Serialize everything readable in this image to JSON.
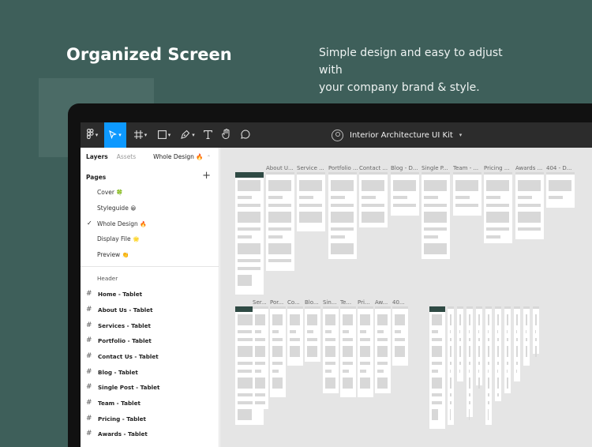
{
  "hero": {
    "title": "Organized Screen",
    "subtitle_line1": "Simple design and easy to adjust with",
    "subtitle_line2": "your company brand & style."
  },
  "toolbar": {
    "file_name": "Interior Architecture UI Kit",
    "accent": "#0d99ff",
    "tools": [
      "figma-menu-icon",
      "move-tool-icon",
      "frame-tool-icon",
      "shape-tool-icon",
      "pen-tool-icon",
      "text-tool-icon",
      "hand-tool-icon",
      "comment-icon"
    ]
  },
  "sidebar": {
    "tab_layers": "Layers",
    "tab_assets": "Assets",
    "current_page": "Whole Design",
    "current_page_emoji": "🔥",
    "pages_heading": "Pages",
    "pages": [
      {
        "label": "Cover",
        "emoji": "🍀"
      },
      {
        "label": "Styleguide",
        "emoji": "😀"
      },
      {
        "label": "Whole Design",
        "emoji": "🔥"
      },
      {
        "label": "Display File",
        "emoji": "🌟"
      },
      {
        "label": "Preview",
        "emoji": "👏"
      }
    ],
    "layers": [
      "Header",
      "Home - Tablet",
      "About Us - Tablet",
      "Services - Tablet",
      "Portfolio - Tablet",
      "Contact Us - Tablet",
      "Blog - Tablet",
      "Single Post - Tablet",
      "Team - Tablet",
      "Pricing - Tablet",
      "Awards - Tablet"
    ]
  },
  "canvas": {
    "row1_labels": [
      "",
      "About U...",
      "Service ...",
      "Portfolio ...",
      "Contact ...",
      "Blog - D...",
      "Single P...",
      "Team - ...",
      "Pricing ...",
      "Awards ...",
      "404 - D..."
    ],
    "row2_labels": [
      "",
      "Ser...",
      "Por...",
      "Co...",
      "Blo...",
      "Sin...",
      "Te...",
      "Pri...",
      "Aw...",
      "40..."
    ]
  }
}
